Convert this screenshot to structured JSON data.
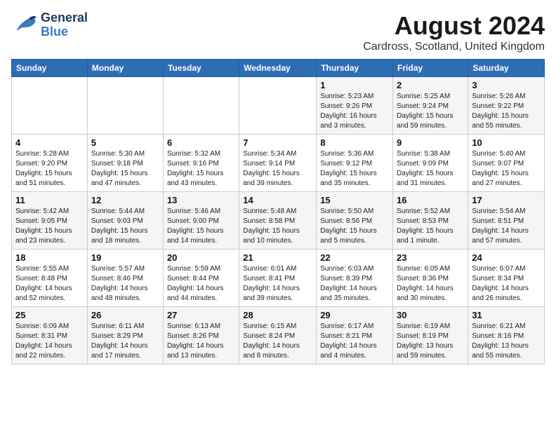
{
  "header": {
    "logo_general": "General",
    "logo_blue": "Blue",
    "month_year": "August 2024",
    "location": "Cardross, Scotland, United Kingdom"
  },
  "days_of_week": [
    "Sunday",
    "Monday",
    "Tuesday",
    "Wednesday",
    "Thursday",
    "Friday",
    "Saturday"
  ],
  "weeks": [
    [
      {
        "day": "",
        "info": ""
      },
      {
        "day": "",
        "info": ""
      },
      {
        "day": "",
        "info": ""
      },
      {
        "day": "",
        "info": ""
      },
      {
        "day": "1",
        "info": "Sunrise: 5:23 AM\nSunset: 9:26 PM\nDaylight: 16 hours\nand 3 minutes."
      },
      {
        "day": "2",
        "info": "Sunrise: 5:25 AM\nSunset: 9:24 PM\nDaylight: 15 hours\nand 59 minutes."
      },
      {
        "day": "3",
        "info": "Sunrise: 5:26 AM\nSunset: 9:22 PM\nDaylight: 15 hours\nand 55 minutes."
      }
    ],
    [
      {
        "day": "4",
        "info": "Sunrise: 5:28 AM\nSunset: 9:20 PM\nDaylight: 15 hours\nand 51 minutes."
      },
      {
        "day": "5",
        "info": "Sunrise: 5:30 AM\nSunset: 9:18 PM\nDaylight: 15 hours\nand 47 minutes."
      },
      {
        "day": "6",
        "info": "Sunrise: 5:32 AM\nSunset: 9:16 PM\nDaylight: 15 hours\nand 43 minutes."
      },
      {
        "day": "7",
        "info": "Sunrise: 5:34 AM\nSunset: 9:14 PM\nDaylight: 15 hours\nand 39 minutes."
      },
      {
        "day": "8",
        "info": "Sunrise: 5:36 AM\nSunset: 9:12 PM\nDaylight: 15 hours\nand 35 minutes."
      },
      {
        "day": "9",
        "info": "Sunrise: 5:38 AM\nSunset: 9:09 PM\nDaylight: 15 hours\nand 31 minutes."
      },
      {
        "day": "10",
        "info": "Sunrise: 5:40 AM\nSunset: 9:07 PM\nDaylight: 15 hours\nand 27 minutes."
      }
    ],
    [
      {
        "day": "11",
        "info": "Sunrise: 5:42 AM\nSunset: 9:05 PM\nDaylight: 15 hours\nand 23 minutes."
      },
      {
        "day": "12",
        "info": "Sunrise: 5:44 AM\nSunset: 9:03 PM\nDaylight: 15 hours\nand 18 minutes."
      },
      {
        "day": "13",
        "info": "Sunrise: 5:46 AM\nSunset: 9:00 PM\nDaylight: 15 hours\nand 14 minutes."
      },
      {
        "day": "14",
        "info": "Sunrise: 5:48 AM\nSunset: 8:58 PM\nDaylight: 15 hours\nand 10 minutes."
      },
      {
        "day": "15",
        "info": "Sunrise: 5:50 AM\nSunset: 8:56 PM\nDaylight: 15 hours\nand 5 minutes."
      },
      {
        "day": "16",
        "info": "Sunrise: 5:52 AM\nSunset: 8:53 PM\nDaylight: 15 hours\nand 1 minute."
      },
      {
        "day": "17",
        "info": "Sunrise: 5:54 AM\nSunset: 8:51 PM\nDaylight: 14 hours\nand 57 minutes."
      }
    ],
    [
      {
        "day": "18",
        "info": "Sunrise: 5:55 AM\nSunset: 8:48 PM\nDaylight: 14 hours\nand 52 minutes."
      },
      {
        "day": "19",
        "info": "Sunrise: 5:57 AM\nSunset: 8:46 PM\nDaylight: 14 hours\nand 48 minutes."
      },
      {
        "day": "20",
        "info": "Sunrise: 5:59 AM\nSunset: 8:44 PM\nDaylight: 14 hours\nand 44 minutes."
      },
      {
        "day": "21",
        "info": "Sunrise: 6:01 AM\nSunset: 8:41 PM\nDaylight: 14 hours\nand 39 minutes."
      },
      {
        "day": "22",
        "info": "Sunrise: 6:03 AM\nSunset: 8:39 PM\nDaylight: 14 hours\nand 35 minutes."
      },
      {
        "day": "23",
        "info": "Sunrise: 6:05 AM\nSunset: 8:36 PM\nDaylight: 14 hours\nand 30 minutes."
      },
      {
        "day": "24",
        "info": "Sunrise: 6:07 AM\nSunset: 8:34 PM\nDaylight: 14 hours\nand 26 minutes."
      }
    ],
    [
      {
        "day": "25",
        "info": "Sunrise: 6:09 AM\nSunset: 8:31 PM\nDaylight: 14 hours\nand 22 minutes."
      },
      {
        "day": "26",
        "info": "Sunrise: 6:11 AM\nSunset: 8:29 PM\nDaylight: 14 hours\nand 17 minutes."
      },
      {
        "day": "27",
        "info": "Sunrise: 6:13 AM\nSunset: 8:26 PM\nDaylight: 14 hours\nand 13 minutes."
      },
      {
        "day": "28",
        "info": "Sunrise: 6:15 AM\nSunset: 8:24 PM\nDaylight: 14 hours\nand 8 minutes."
      },
      {
        "day": "29",
        "info": "Sunrise: 6:17 AM\nSunset: 8:21 PM\nDaylight: 14 hours\nand 4 minutes."
      },
      {
        "day": "30",
        "info": "Sunrise: 6:19 AM\nSunset: 8:19 PM\nDaylight: 13 hours\nand 59 minutes."
      },
      {
        "day": "31",
        "info": "Sunrise: 6:21 AM\nSunset: 8:16 PM\nDaylight: 13 hours\nand 55 minutes."
      }
    ]
  ]
}
